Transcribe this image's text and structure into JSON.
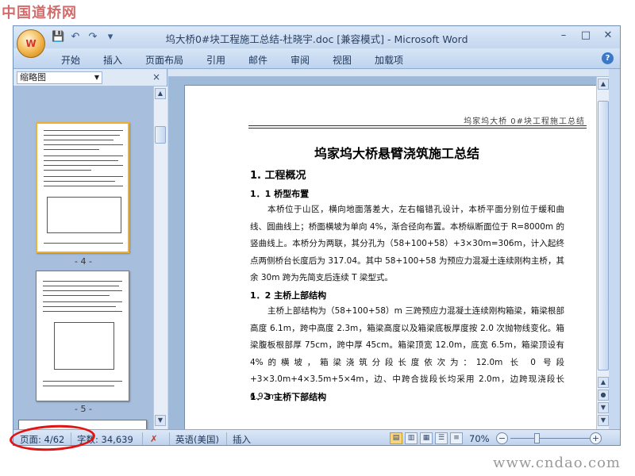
{
  "watermarks": {
    "top": "中国道桥网",
    "bottom": "www.cndao.com"
  },
  "title_bar": {
    "title": "坞大桥0#块工程施工总结-杜晓宇.doc [兼容模式] - Microsoft Word",
    "office_button": "W",
    "qat": {
      "save": "💾",
      "undo": "↶",
      "redo": "↷",
      "customize": "▾"
    },
    "window_controls": {
      "minimize": "–",
      "maximize": "□",
      "close": "✕"
    }
  },
  "ribbon": {
    "tabs": [
      "开始",
      "插入",
      "页面布局",
      "引用",
      "邮件",
      "审阅",
      "视图",
      "加载项"
    ],
    "help": "?"
  },
  "thumbnail_pane": {
    "dropdown": "缩略图",
    "close": "×",
    "page_labels": [
      "- 4 -",
      "- 5 -"
    ]
  },
  "document": {
    "header": "坞家坞大桥 0#块工程施工总结",
    "title": "坞家坞大桥悬臂浇筑施工总结",
    "sections": [
      {
        "heading": "1. 工程概况"
      },
      {
        "heading": "1．1 桥型布置"
      }
    ],
    "para1": "本桥位于山区，横向地面落差大，左右幅错孔设计，本桥平面分别位于缓和曲线、圆曲线上；桥面横坡为单向 4%，渐合径向布置。本桥纵断面位于 R=8000m 的竖曲线上。本桥分为两联，其分孔为（58+100+58）+3×30m=306m，计入起终点两侧桥台长度后为 317.04。其中 58+100+58 为预应力混凝土连续刚构主桥，其余 30m 跨为先简支后连续 T 梁型式。",
    "heading_12": "1．2 主桥上部结构",
    "para2": "主桥上部结构为（58+100+58）m 三跨预应力混凝土连续刚构箱梁，箱梁根部高度 6.1m，跨中高度 2.3m，箱梁高度以及箱梁底板厚度按 2.0 次抛物线变化。箱梁腹板根部厚 75cm，跨中厚 45cm。箱梁顶宽 12.0m，底宽 6.5m，箱梁顶设有 4%的横坡，箱梁浇筑分段长度依次为：12.0m 长 0 号段+3×3.0m+4×3.5m+5×4m，边、中跨合拢段长均采用 2.0m，边跨现浇段长 6.92m。",
    "heading_13": "1．3 主桥下部结构"
  },
  "status_bar": {
    "page": "页面: 4/62",
    "words": "字数: 34,639",
    "proof_icon": "✗",
    "language": "英语(美国)",
    "mode": "插入",
    "zoom": "70%",
    "zoom_level": 0.7,
    "zoom_minus": "−",
    "zoom_plus": "+"
  },
  "annotation": {
    "color": "#e01414"
  }
}
